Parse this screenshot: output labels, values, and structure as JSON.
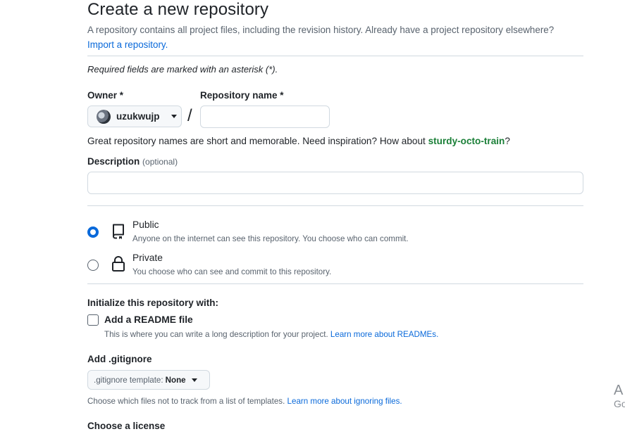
{
  "header": {
    "title": "Create a new repository",
    "intro": "A repository contains all project files, including the revision history. Already have a project repository elsewhere?",
    "import_link": "Import a repository."
  },
  "required_note": "Required fields are marked with an asterisk (*).",
  "owner": {
    "label": "Owner *",
    "name": "uzukwujp",
    "icons": {
      "caret": "triangle-down-icon",
      "avatar": "user-avatar"
    }
  },
  "slash": "/",
  "repo_name": {
    "label": "Repository name *",
    "value": ""
  },
  "name_hint": {
    "prefix": "Great repository names are short and memorable. Need inspiration? How about",
    "suggestion": "sturdy-octo-train",
    "suffix": "?"
  },
  "description": {
    "label": "Description",
    "optional": "(optional)",
    "value": ""
  },
  "visibility": {
    "selected": "public",
    "options": [
      {
        "id": "public",
        "label": "Public",
        "description": "Anyone on the internet can see this repository. You choose who can commit.",
        "icon": "repo-icon"
      },
      {
        "id": "private",
        "label": "Private",
        "description": "You choose who can see and commit to this repository.",
        "icon": "lock-icon"
      }
    ]
  },
  "initialize": {
    "title": "Initialize this repository with:",
    "readme_label": "Add a README file",
    "readme_checked": false,
    "readme_desc": "This is where you can write a long description for your project.",
    "readme_link": "Learn more about READMEs."
  },
  "gitignore": {
    "label": "Add .gitignore",
    "button_prefix": ".gitignore template:",
    "button_value": "None",
    "desc": "Choose which files not to track from a list of templates.",
    "link": "Learn more about ignoring files."
  },
  "license": {
    "label": "Choose a license"
  },
  "edge_overlay": {
    "line1": "A",
    "line2": "Go"
  },
  "colors": {
    "accent": "#0969da",
    "suggestion": "#1a7f37",
    "muted": "#59636e",
    "border": "#d1d9e0"
  }
}
